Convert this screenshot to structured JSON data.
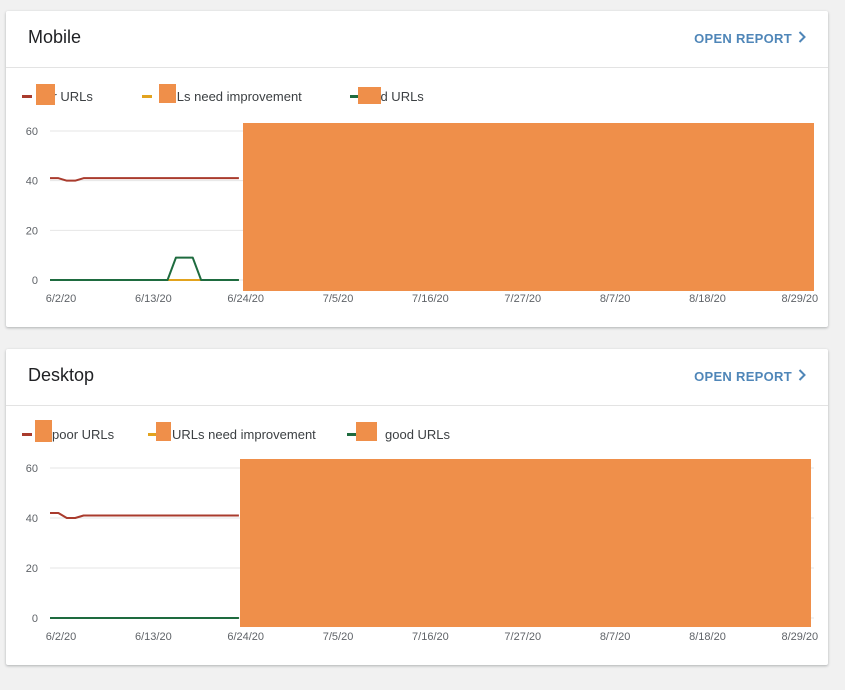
{
  "colors": {
    "poor": "#a93b2d",
    "need_improvement": "#e2a31e",
    "good": "#1e6b3f",
    "redaction": "#ef8f4a",
    "link": "#4f86b8",
    "grid": "#e6e6e6"
  },
  "panels": [
    {
      "title": "Mobile",
      "open_report_label": "OPEN REPORT",
      "legend": {
        "poor": "oor URLs",
        "need_improvement": "URLs need improvement",
        "good": "ood URLs"
      },
      "chart_data": {
        "type": "line",
        "x_tick_labels": [
          "6/2/20",
          "6/13/20",
          "6/24/20",
          "7/5/20",
          "7/16/20",
          "7/27/20",
          "8/7/20",
          "8/18/20",
          "8/29/20"
        ],
        "y_ticks": [
          0,
          20,
          40,
          60
        ],
        "ylim": [
          0,
          60
        ],
        "x_days_range": [
          0,
          91
        ],
        "visible_until_day": 22.5,
        "series": [
          {
            "key": "poor",
            "x_days": [
              0,
              1,
              2,
              3,
              4,
              5,
              22.5
            ],
            "y": [
              41,
              41,
              40,
              40,
              41,
              41,
              41
            ]
          },
          {
            "key": "need_improvement",
            "x_days": [
              0,
              22.5
            ],
            "y": [
              0,
              0
            ]
          },
          {
            "key": "good",
            "x_days": [
              0,
              14,
              15,
              17,
              18,
              22.5
            ],
            "y": [
              0,
              0,
              9,
              9,
              0,
              0
            ]
          }
        ]
      }
    },
    {
      "title": "Desktop",
      "open_report_label": "OPEN REPORT",
      "legend": {
        "poor": "poor URLs",
        "need_improvement": "URLs need improvement",
        "good": "good URLs"
      },
      "chart_data": {
        "type": "line",
        "x_tick_labels": [
          "6/2/20",
          "6/13/20",
          "6/24/20",
          "7/5/20",
          "7/16/20",
          "7/27/20",
          "8/7/20",
          "8/18/20",
          "8/29/20"
        ],
        "y_ticks": [
          0,
          20,
          40,
          60
        ],
        "ylim": [
          0,
          60
        ],
        "x_days_range": [
          0,
          91
        ],
        "visible_until_day": 22.5,
        "series": [
          {
            "key": "poor",
            "x_days": [
              0,
              1,
              2,
              3,
              4,
              5,
              22.5
            ],
            "y": [
              42,
              42,
              40,
              40,
              41,
              41,
              41
            ]
          },
          {
            "key": "need_improvement",
            "x_days": [
              0,
              22.5
            ],
            "y": [
              0,
              0
            ]
          },
          {
            "key": "good",
            "x_days": [
              0,
              22.5
            ],
            "y": [
              0,
              0
            ]
          }
        ]
      }
    }
  ]
}
